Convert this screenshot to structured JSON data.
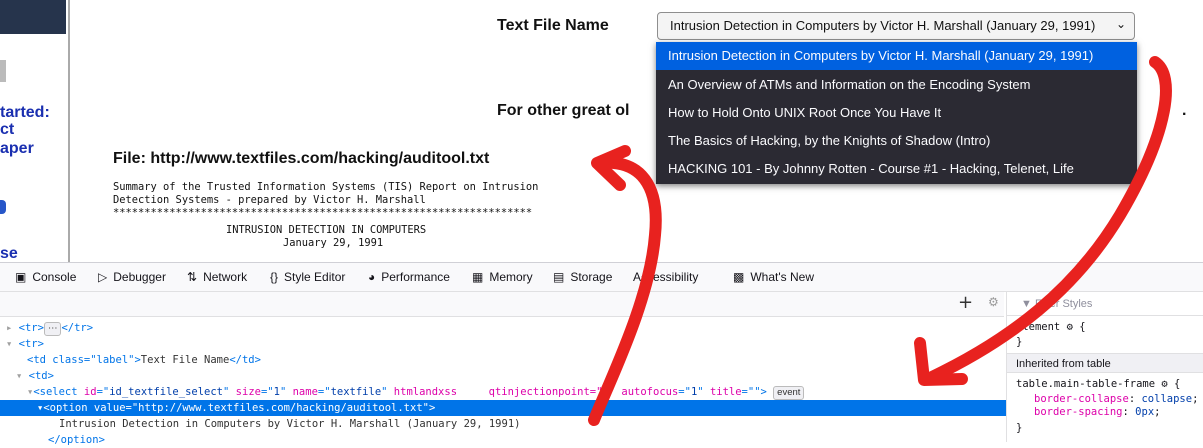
{
  "sidebar": {
    "text1": "tarted:",
    "text2": "ct",
    "text3": "aper",
    "text4": "se"
  },
  "main": {
    "text_file_label": "Text File Name",
    "selected_value": "Intrusion Detection in Computers by Victor H. Marshall (January 29, 1991)",
    "options": [
      "Intrusion Detection in Computers by Victor H. Marshall (January 29, 1991)",
      "An Overview of ATMs and Information on the Encoding System",
      "How to Hold Onto UNIX Root Once You Have It",
      "The Basics of Hacking, by the Knights of Shadow (Intro)",
      "HACKING 101 - By Johnny Rotten - Course #1 - Hacking, Telenet, Life"
    ],
    "other_text": "For other great ol",
    "trailing_link": "/",
    "trailing_dot": ".",
    "file_heading": "File: http://www.textfiles.com/hacking/auditool.txt",
    "content_lines": [
      "Summary of the Trusted Information Systems (TIS) Report on Intrusion",
      "Detection Systems - prepared by Victor H. Marshall",
      "*******************************************************************",
      "INTRUSION DETECTION IN COMPUTERS",
      "January 29, 1991"
    ]
  },
  "devtools": {
    "tabs": [
      "Console",
      "Debugger",
      "Network",
      "Style Editor",
      "Performance",
      "Memory",
      "Storage",
      "Accessibility",
      "What's New"
    ],
    "markup": {
      "row_tr_collapsed": "<tr>",
      "row_tr_collapsed_close": "</tr>",
      "row_tr": "<tr>",
      "td_label_open": "<td class=\"label\">",
      "td_label_text": "Text File Name",
      "td_label_close": "</td>",
      "td_open": "<td>",
      "select_id": "id_textfile_select",
      "select_size": "1",
      "select_name": "textfile",
      "select_attr4": "htmlandxss",
      "select_attr5": "qtinjectionpoint=\"1\"",
      "select_autofocus": "1",
      "select_title": "",
      "event_badge": "event",
      "option_value": "http://www.textfiles.com/hacking/auditool.txt",
      "option_text": "Intrusion Detection in Computers by Victor H. Marshall (January 29, 1991)",
      "option_close": "</option>"
    },
    "rules": {
      "filter_placeholder": "Filter Styles",
      "element_selector": "element",
      "close_brace": "}",
      "inherited_label": "Inherited from table",
      "table_selector": "table.main-table-frame",
      "prop1_name": "border-collapse",
      "prop1_value": "collapse",
      "prop2_name": "border-spacing",
      "prop2_value": "0px"
    }
  },
  "colors": {
    "dropdown_bg": "#2b2a33",
    "dropdown_selected": "#0061e0",
    "markup_selected": "#0074e8",
    "annotation_red": "#e8221f"
  }
}
